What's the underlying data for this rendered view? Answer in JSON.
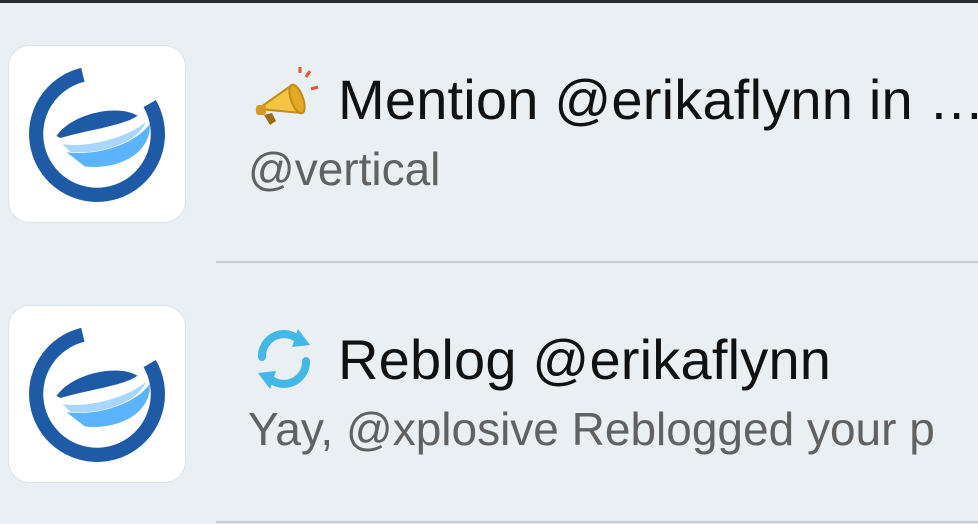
{
  "notifications": [
    {
      "icon": "megaphone-icon",
      "title": "Mention @erikaflynn in …",
      "subtitle": "@vertical",
      "avatar_icon": "app-logo-e-icon"
    },
    {
      "icon": "reblog-arrows-icon",
      "title": "Reblog @erikaflynn",
      "subtitle": "Yay, @xplosive Reblogged your p",
      "avatar_icon": "app-logo-e-icon"
    }
  ],
  "colors": {
    "background": "#e9eff3",
    "logo_dark_blue": "#1f5aa6",
    "logo_light_blue": "#5cb3ff",
    "reblog_blue": "#43b7e6",
    "megaphone_yellow": "#f5c542"
  }
}
